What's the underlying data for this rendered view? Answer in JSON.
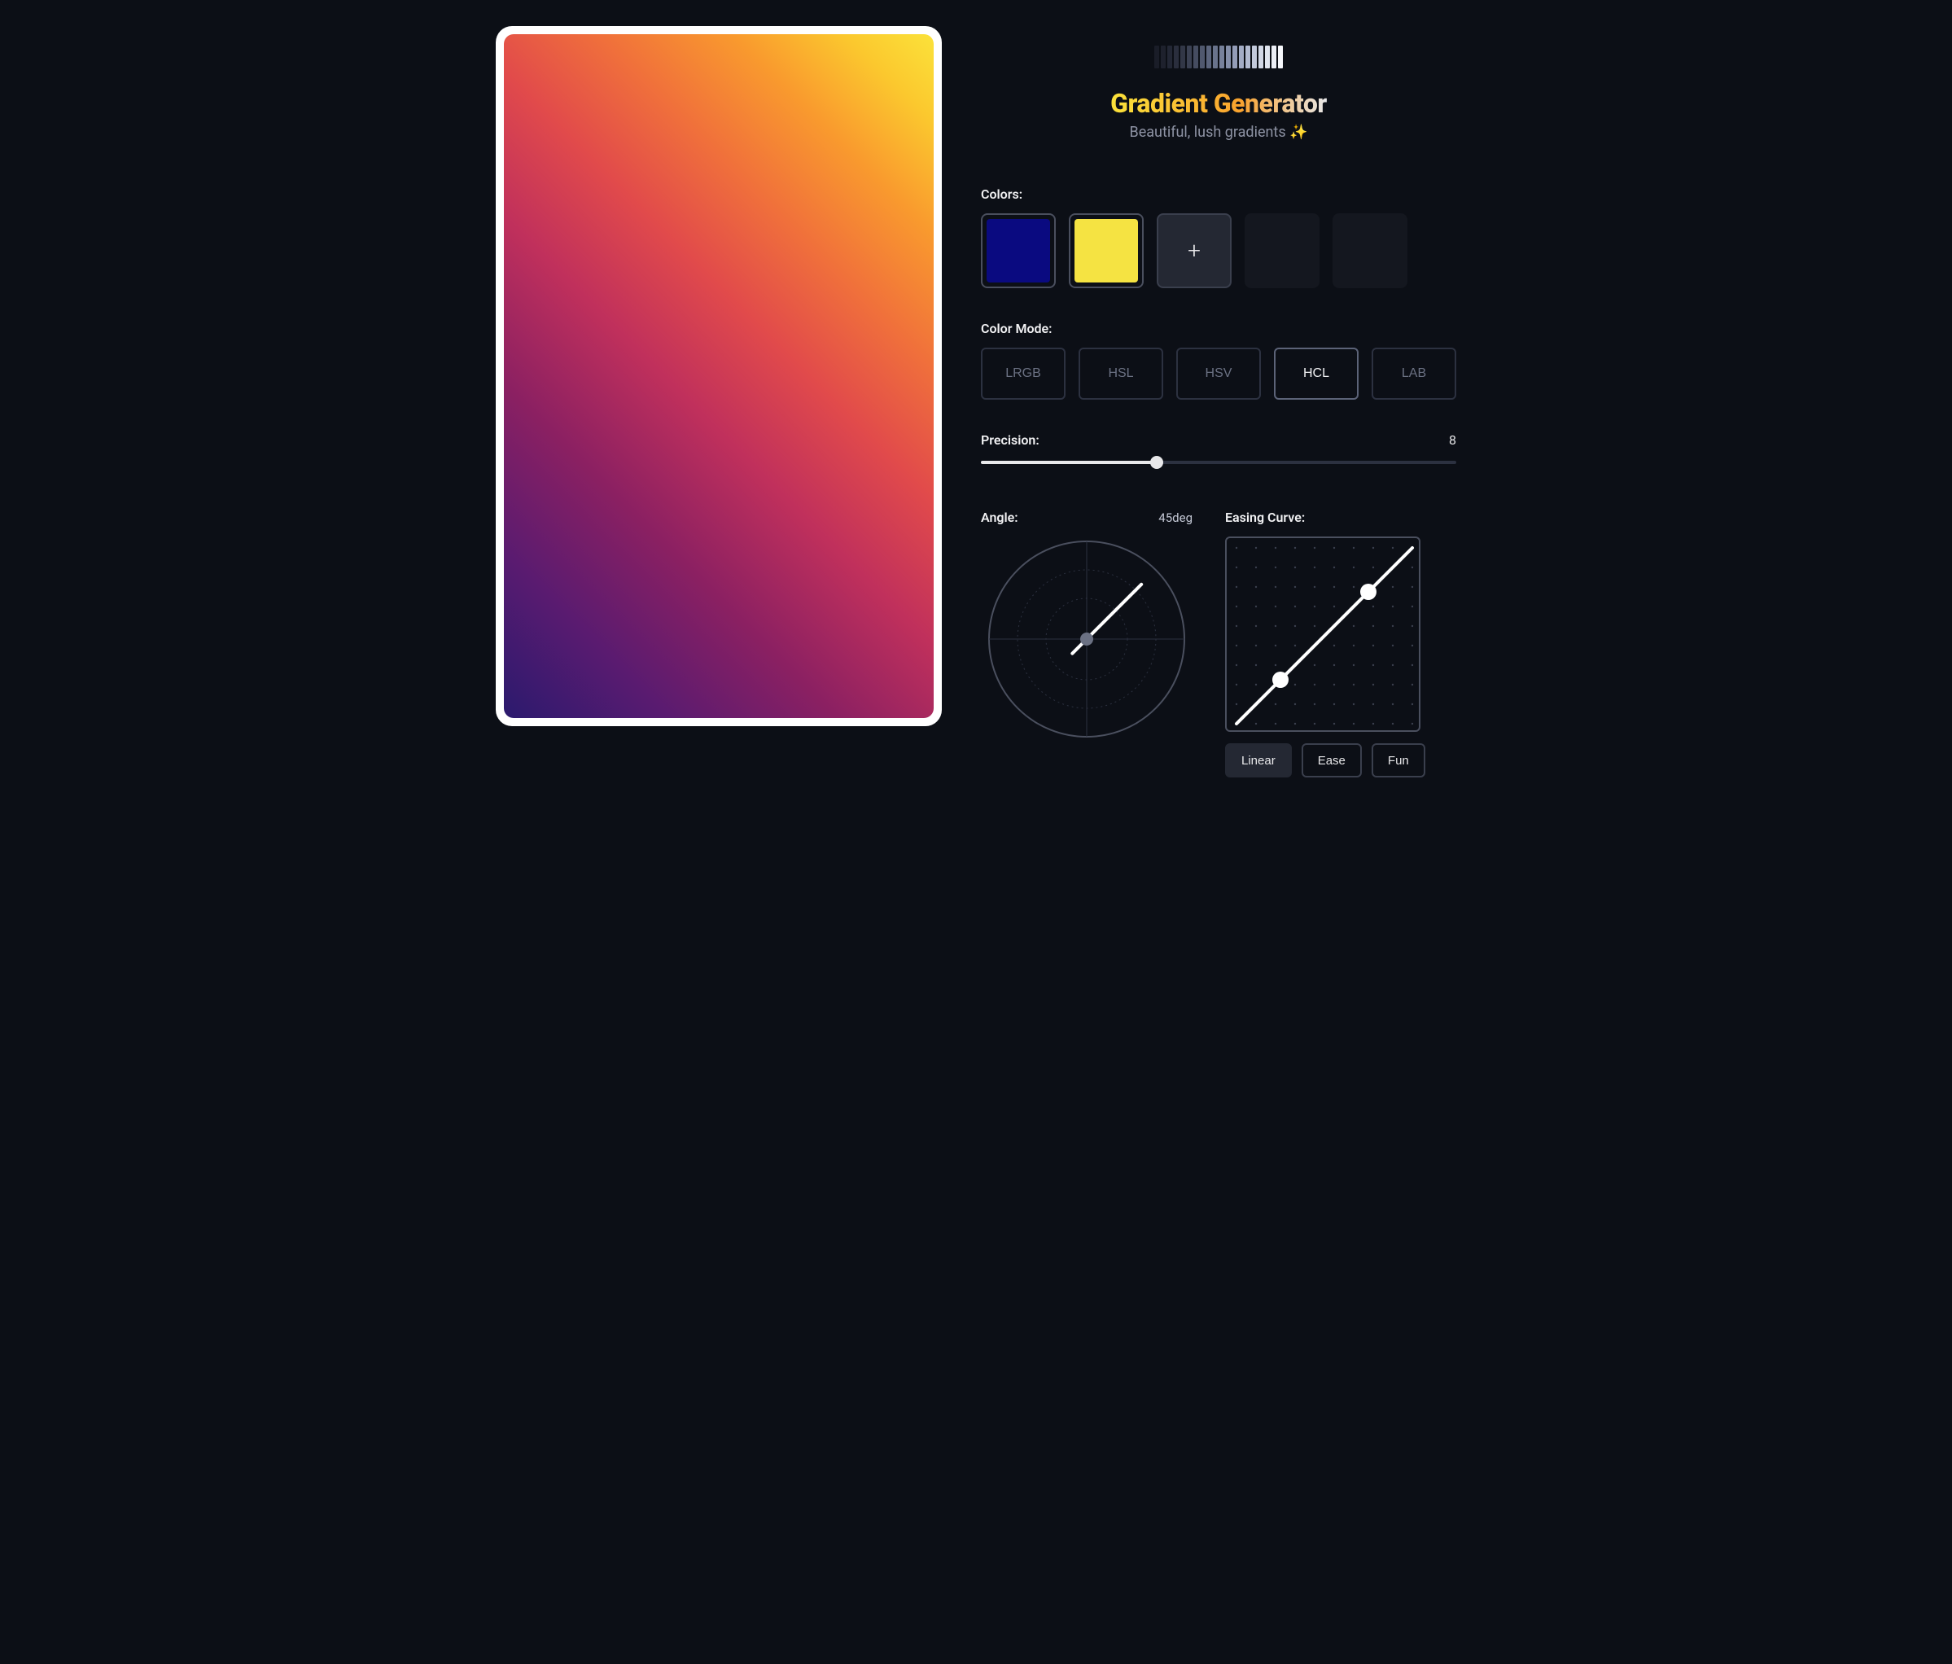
{
  "header": {
    "title": "Gradient Generator",
    "subtitle": "Beautiful, lush gradients ✨"
  },
  "logo_strip_colors": [
    "#1a1d28",
    "#1e212d",
    "#232735",
    "#2a2e3d",
    "#323747",
    "#3b4153",
    "#454c60",
    "#50586e",
    "#5c657d",
    "#69738c",
    "#77819b",
    "#858faa",
    "#949db8",
    "#a3acc5",
    "#b3bbd1",
    "#c3cadc",
    "#d2d8e6",
    "#e0e5ef",
    "#eceff6",
    "#f6f7fb"
  ],
  "colors": {
    "label": "Colors:",
    "swatches": [
      "#0a0a80",
      "#f5e342"
    ],
    "max_slots": 5
  },
  "color_mode": {
    "label": "Color Mode:",
    "options": [
      "LRGB",
      "HSL",
      "HSV",
      "HCL",
      "LAB"
    ],
    "selected": "HCL"
  },
  "precision": {
    "label": "Precision:",
    "value": 8,
    "min": 0,
    "max": 20,
    "fill_percent": 37
  },
  "angle": {
    "label": "Angle:",
    "value_text": "45deg",
    "degrees": 45
  },
  "easing": {
    "label": "Easing Curve:",
    "control_points": [
      [
        0.25,
        0.25
      ],
      [
        0.75,
        0.75
      ]
    ],
    "presets": [
      "Linear",
      "Ease",
      "Fun"
    ],
    "selected_preset": "Linear"
  },
  "icons": {
    "add": "+"
  }
}
